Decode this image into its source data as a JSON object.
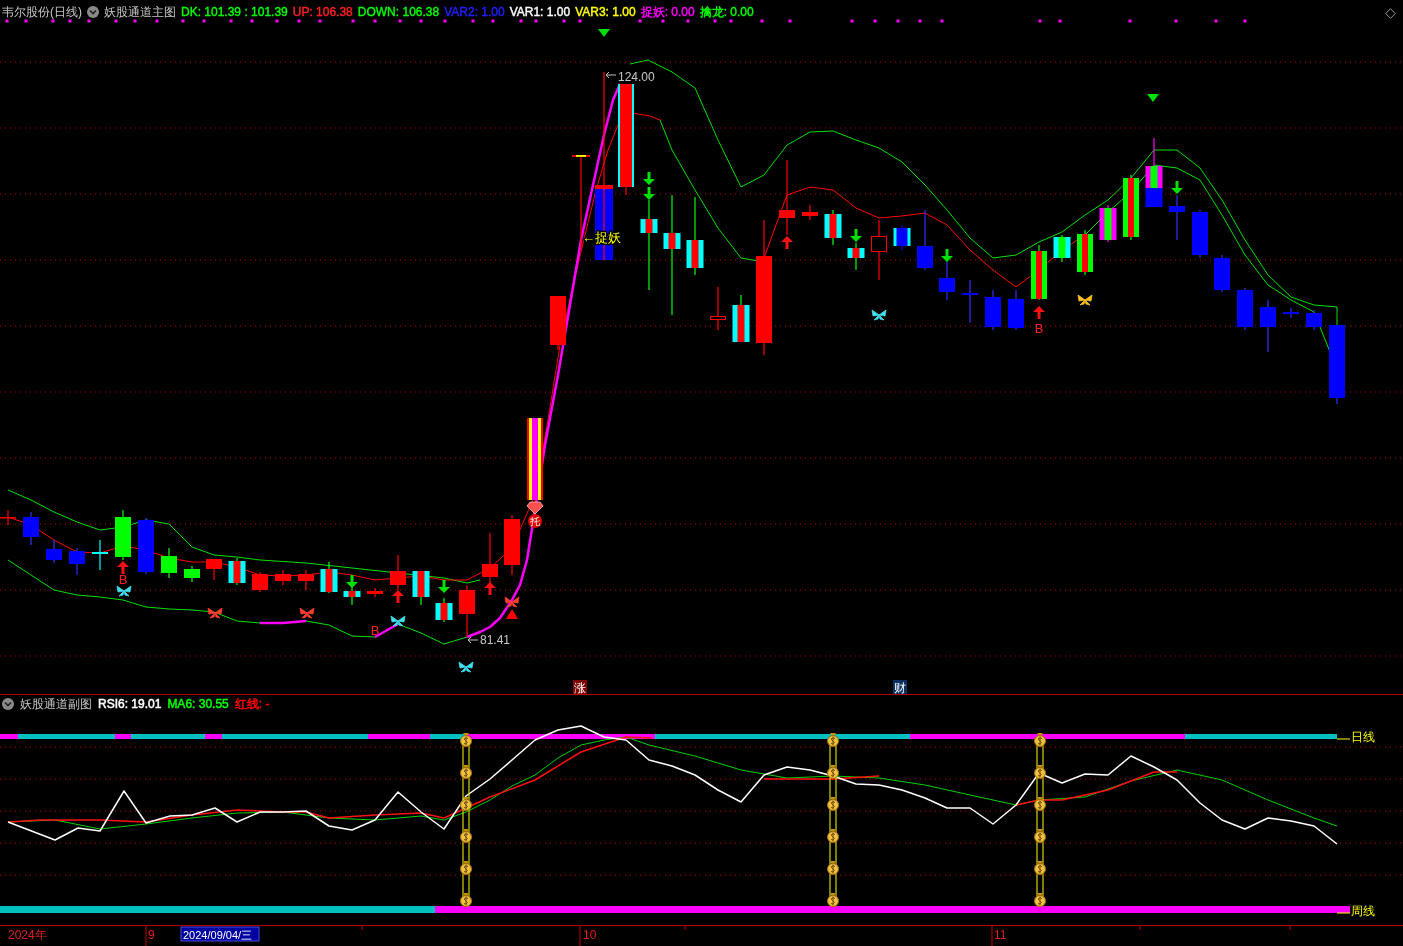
{
  "main_panel": {
    "stock_title": "韦尔股份(日线)",
    "indicator_name": "妖股通道主图",
    "readouts": [
      {
        "text": "DK: 101.39 : 101.39",
        "color": "#00ff00"
      },
      {
        "text": "UP: 106.38",
        "color": "#ff2020"
      },
      {
        "text": "DOWN: 106.38",
        "color": "#00ff00"
      },
      {
        "text": "VAR2: 1.00",
        "color": "#2020ff"
      },
      {
        "text": "VAR1: 1.00",
        "color": "#ffffff"
      },
      {
        "text": "VAR3: 1.00",
        "color": "#ffff00"
      },
      {
        "text": "捉妖: 0.00",
        "color": "#ff00ff"
      },
      {
        "text": "擒龙: 0.00",
        "color": "#00ff00"
      }
    ],
    "price_labels": [
      {
        "kind": "high",
        "text": "124.00"
      },
      {
        "kind": "low",
        "text": "81.41"
      }
    ],
    "signal_label": "←捉妖",
    "buy_marks": [
      "B",
      "B",
      "B"
    ],
    "support_badge": "托",
    "event_tags": [
      {
        "text": "涨",
        "color": "#800000"
      },
      {
        "text": "财",
        "color": "#0a3060"
      }
    ]
  },
  "sub_panel": {
    "indicator_name": "妖股通道副图",
    "readouts": [
      {
        "text": "RSI6: 19.01",
        "color": "#ffffff"
      },
      {
        "text": "MA6: 30.55",
        "color": "#00ff00"
      },
      {
        "text": "红线: -",
        "color": "#ff0000"
      }
    ],
    "trend_labels": [
      "日线",
      "周线"
    ]
  },
  "time_axis": {
    "labels": [
      {
        "kind": "year",
        "text": "2024年"
      },
      {
        "kind": "month",
        "text": "9"
      },
      {
        "kind": "cursor",
        "text": "2024/09/04/三"
      },
      {
        "kind": "month",
        "text": "10"
      },
      {
        "kind": "month",
        "text": "11"
      }
    ]
  }
}
